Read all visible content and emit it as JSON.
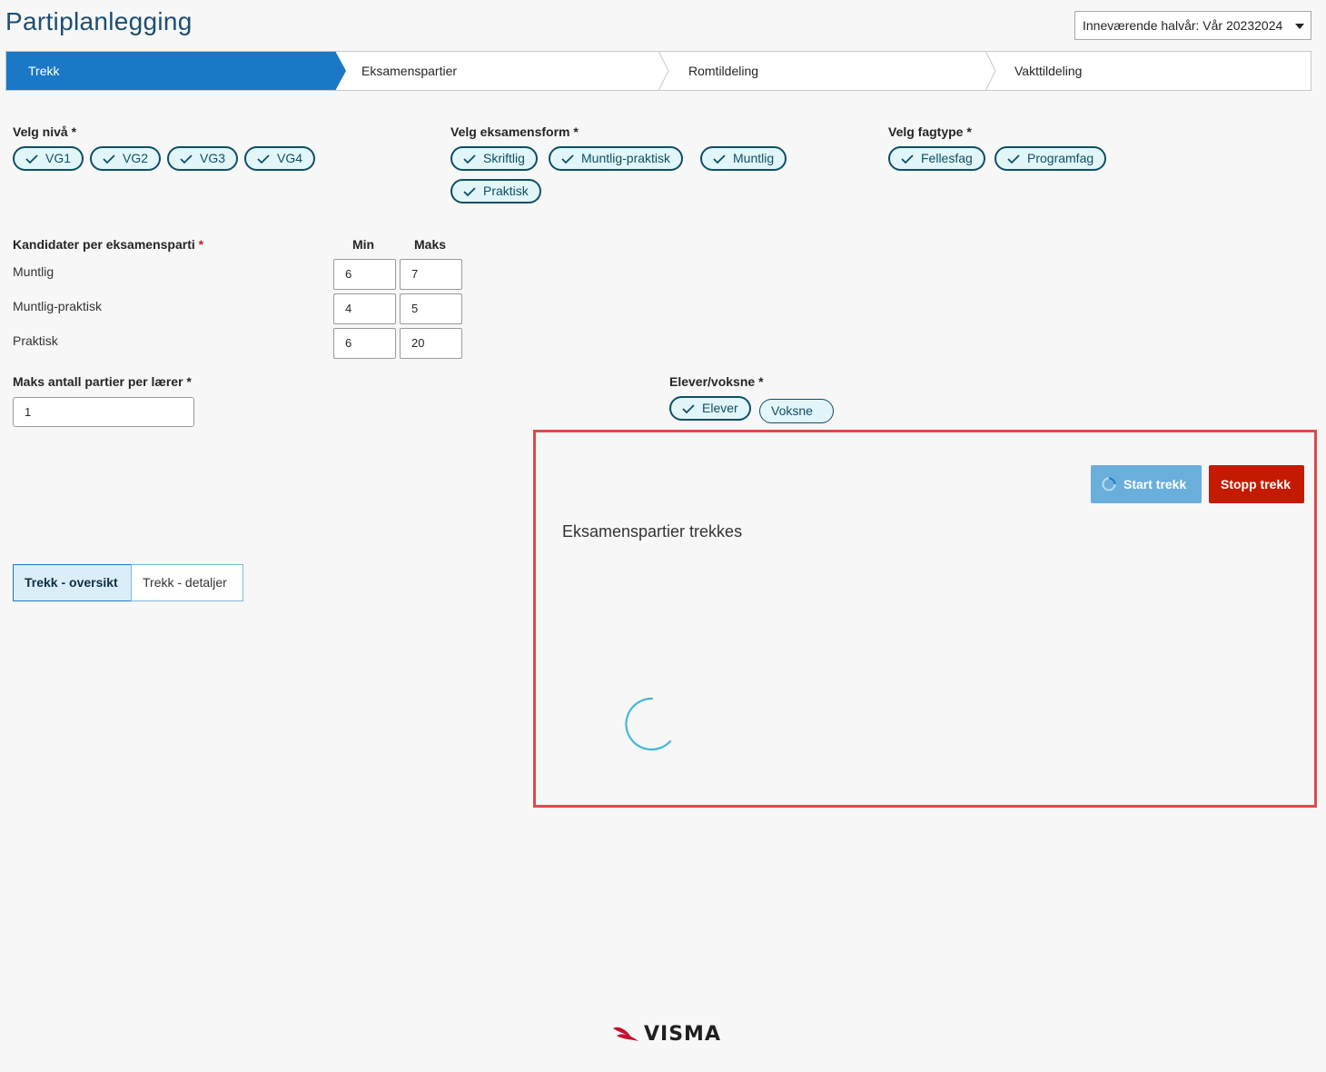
{
  "header": {
    "title": "Partiplanlegging",
    "term_select": "Inneværende halvår: Vår 20232024"
  },
  "wizard": {
    "steps": [
      "Trekk",
      "Eksamenspartier",
      "Romtildeling",
      "Vakttildeling"
    ],
    "active": "Trekk"
  },
  "filters": {
    "level": {
      "label": "Velg nivå",
      "required": "*",
      "options": [
        "VG1",
        "VG2",
        "VG3",
        "VG4"
      ]
    },
    "exam_form": {
      "label": "Velg eksamensform",
      "required": "*",
      "options": [
        "Skriftlig",
        "Muntlig-praktisk",
        "Muntlig",
        "Praktisk"
      ]
    },
    "subject_type": {
      "label": "Velg fagtype",
      "required": "*",
      "options": [
        "Fellesfag",
        "Programfag"
      ]
    }
  },
  "candidates": {
    "label": "Kandidater per eksamensparti",
    "required": "*",
    "col_min": "Min",
    "col_max": "Maks",
    "rows": [
      {
        "name": "Muntlig",
        "min": "6",
        "max": "7"
      },
      {
        "name": "Muntlig-praktisk",
        "min": "4",
        "max": "5"
      },
      {
        "name": "Praktisk",
        "min": "6",
        "max": "20"
      }
    ]
  },
  "max_parties": {
    "label": "Maks antall partier per lærer",
    "required": "*",
    "value": "1"
  },
  "students": {
    "label": "Elever/voksne",
    "required": "*",
    "options": [
      {
        "label": "Elever",
        "selected": true
      },
      {
        "label": "Voksne",
        "selected": false
      }
    ]
  },
  "tabs": {
    "overview": "Trekk - oversikt",
    "details": "Trekk - detaljer",
    "active": "overview"
  },
  "panel": {
    "start_button": "Start trekk",
    "stop_button": "Stopp trekk",
    "status": "Eksamenspartier trekkes"
  },
  "footer": {
    "logo": "VISMA"
  },
  "colors": {
    "primary": "#1b78c7",
    "stop": "#c41b00",
    "chip_border": "#0d4f63",
    "highlight": "#dc4a4a"
  },
  "icons": [
    "check-icon",
    "caret-down-icon",
    "spinner-icon",
    "visma-logo"
  ]
}
